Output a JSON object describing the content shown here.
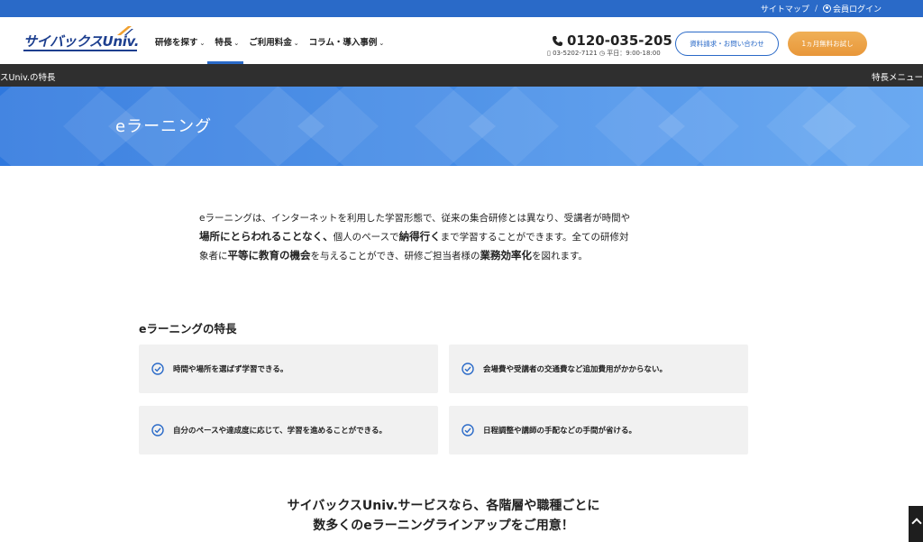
{
  "topbar": {
    "sitemap": "サイトマップ",
    "separator": "/",
    "login": "会員ログイン"
  },
  "header": {
    "logo": "サイバックスUniv.",
    "nav": [
      {
        "label": "研修を探す",
        "chevron": "⌄"
      },
      {
        "label": "特長",
        "chevron": "⌄"
      },
      {
        "label": "ご利用料金",
        "chevron": "⌄"
      },
      {
        "label": "コラム・導入事例",
        "chevron": "⌄"
      }
    ],
    "phone": "0120-035-205",
    "phone_sub": "03-5202-7121",
    "hours": "平日：9:00-18:00",
    "contact_button": "資料請求・お問い合わせ",
    "trial_button": "1ヵ月無料お試し"
  },
  "darkbar": {
    "left": "スUniv.の特長",
    "right": "特長メニュー"
  },
  "hero": {
    "title": "eラーニング"
  },
  "intro": {
    "p1": "eラーニングは、インターネットを利用した学習形態で、従来の集合研修とは異なり、受講者が時間や",
    "p2_bold": "場所にとらわれることなく、",
    "p2a": "個人のペースで",
    "p2_bold2": "納得行く",
    "p2b": "まで学習することができます。全ての研修対",
    "p3a": "象者に",
    "p3_bold": "平等に教育の機会",
    "p3b": "を与えることができ、研修ご担当者様の",
    "p3_bold2": "業務効率化",
    "p3c": "を図れます。"
  },
  "features": {
    "heading": "eラーニングの特長",
    "items": [
      "時間や場所を選ばず学習できる。",
      "会場費や受講者の交通費など追加費用がかからない。",
      "自分のペースや達成度に応じて、学習を進めることができる。",
      "日程調整や講師の手配などの手間が省ける。"
    ]
  },
  "bottom": {
    "line1": "サイバックスUniv.サービスなら、各階層や職種ごとに",
    "line2": "数多くのeラーニングラインアップをご用意！"
  },
  "colors": {
    "brand_blue": "#2a6ac8",
    "trial_orange": "#e8973a",
    "dark_bar": "#2f2f2f",
    "card_bg": "#f1f1f1"
  }
}
